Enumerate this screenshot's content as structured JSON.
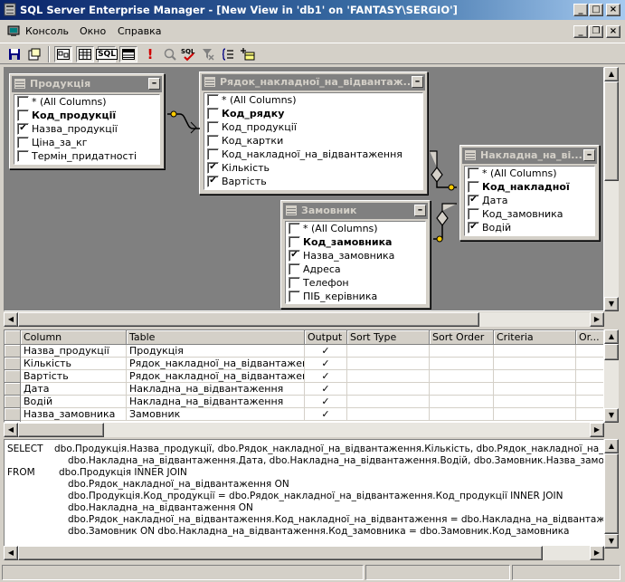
{
  "window": {
    "title": "SQL Server Enterprise Manager - [New View in 'db1' on 'FANTASY\\SERGIO']"
  },
  "menu": {
    "items": [
      "Консоль",
      "Окно",
      "Справка"
    ]
  },
  "toolbar": {
    "sql_label": "SQL"
  },
  "diagram": {
    "tables": [
      {
        "name": "Продукція",
        "columns": [
          {
            "label": "* (All Columns)",
            "checked": false,
            "bold": false
          },
          {
            "label": "Код_продукції",
            "checked": false,
            "bold": true
          },
          {
            "label": "Назва_продукції",
            "checked": true,
            "bold": false
          },
          {
            "label": "Ціна_за_кг",
            "checked": false,
            "bold": false
          },
          {
            "label": "Термін_придатності",
            "checked": false,
            "bold": false
          }
        ]
      },
      {
        "name": "Рядок_накладної_на_відвантаж...",
        "columns": [
          {
            "label": "* (All Columns)",
            "checked": false,
            "bold": false
          },
          {
            "label": "Код_рядку",
            "checked": false,
            "bold": true
          },
          {
            "label": "Код_продукції",
            "checked": false,
            "bold": false
          },
          {
            "label": "Код_картки",
            "checked": false,
            "bold": false
          },
          {
            "label": "Код_накладної_на_відвантаження",
            "checked": false,
            "bold": false
          },
          {
            "label": "Кількість",
            "checked": true,
            "bold": false
          },
          {
            "label": "Вартість",
            "checked": true,
            "bold": false
          }
        ]
      },
      {
        "name": "Накладна_на_ві...",
        "columns": [
          {
            "label": "* (All Columns)",
            "checked": false,
            "bold": false
          },
          {
            "label": "Код_накладної",
            "checked": false,
            "bold": true
          },
          {
            "label": "Дата",
            "checked": true,
            "bold": false
          },
          {
            "label": "Код_замовника",
            "checked": false,
            "bold": false
          },
          {
            "label": "Водій",
            "checked": true,
            "bold": false
          }
        ]
      },
      {
        "name": "Замовник",
        "columns": [
          {
            "label": "* (All Columns)",
            "checked": false,
            "bold": false
          },
          {
            "label": "Код_замовника",
            "checked": false,
            "bold": true
          },
          {
            "label": "Назва_замовника",
            "checked": true,
            "bold": false
          },
          {
            "label": "Адреса",
            "checked": false,
            "bold": false
          },
          {
            "label": "Телефон",
            "checked": false,
            "bold": false
          },
          {
            "label": "ПІБ_керівника",
            "checked": false,
            "bold": false
          }
        ]
      }
    ]
  },
  "grid": {
    "headers": [
      "Column",
      "Table",
      "Output",
      "Sort Type",
      "Sort Order",
      "Criteria",
      "Or..."
    ],
    "rows": [
      {
        "column": "Назва_продукції",
        "table": "Продукція",
        "output": "✓"
      },
      {
        "column": "Кількість",
        "table": "Рядок_накладної_на_відвантажен",
        "output": "✓"
      },
      {
        "column": "Вартість",
        "table": "Рядок_накладної_на_відвантажен",
        "output": "✓"
      },
      {
        "column": "Дата",
        "table": "Накладна_на_відвантаження",
        "output": "✓"
      },
      {
        "column": "Водій",
        "table": "Накладна_на_відвантаження",
        "output": "✓"
      },
      {
        "column": "Назва_замовника",
        "table": "Замовник",
        "output": "✓"
      }
    ]
  },
  "sql": {
    "lines": [
      {
        "kw": "SELECT",
        "text": "dbo.Продукція.Назва_продукції, dbo.Рядок_накладної_на_відвантаження.Кількість, dbo.Рядок_накладної_на_відвант"
      },
      {
        "kw": "",
        "text": "dbo.Накладна_на_відвантаження.Дата, dbo.Накладна_на_відвантаження.Водій, dbo.Замовник.Назва_замовника"
      },
      {
        "kw": "FROM",
        "text": "dbo.Продукція INNER JOIN"
      },
      {
        "kw": "",
        "text": "dbo.Рядок_накладної_на_відвантаження ON"
      },
      {
        "kw": "",
        "text": "dbo.Продукція.Код_продукції = dbo.Рядок_накладної_на_відвантаження.Код_продукції INNER JOIN"
      },
      {
        "kw": "",
        "text": "dbo.Накладна_на_відвантаження ON"
      },
      {
        "kw": "",
        "text": "dbo.Рядок_накладної_на_відвантаження.Код_накладної_на_відвантаження = dbo.Накладна_на_відвантаження.К"
      },
      {
        "kw": "",
        "text": "dbo.Замовник ON dbo.Накладна_на_відвантаження.Код_замовника = dbo.Замовник.Код_замовника"
      }
    ]
  },
  "colors": {
    "title_active": "#0a246a",
    "face": "#d4d0c8",
    "diagram_bg": "#808080"
  }
}
